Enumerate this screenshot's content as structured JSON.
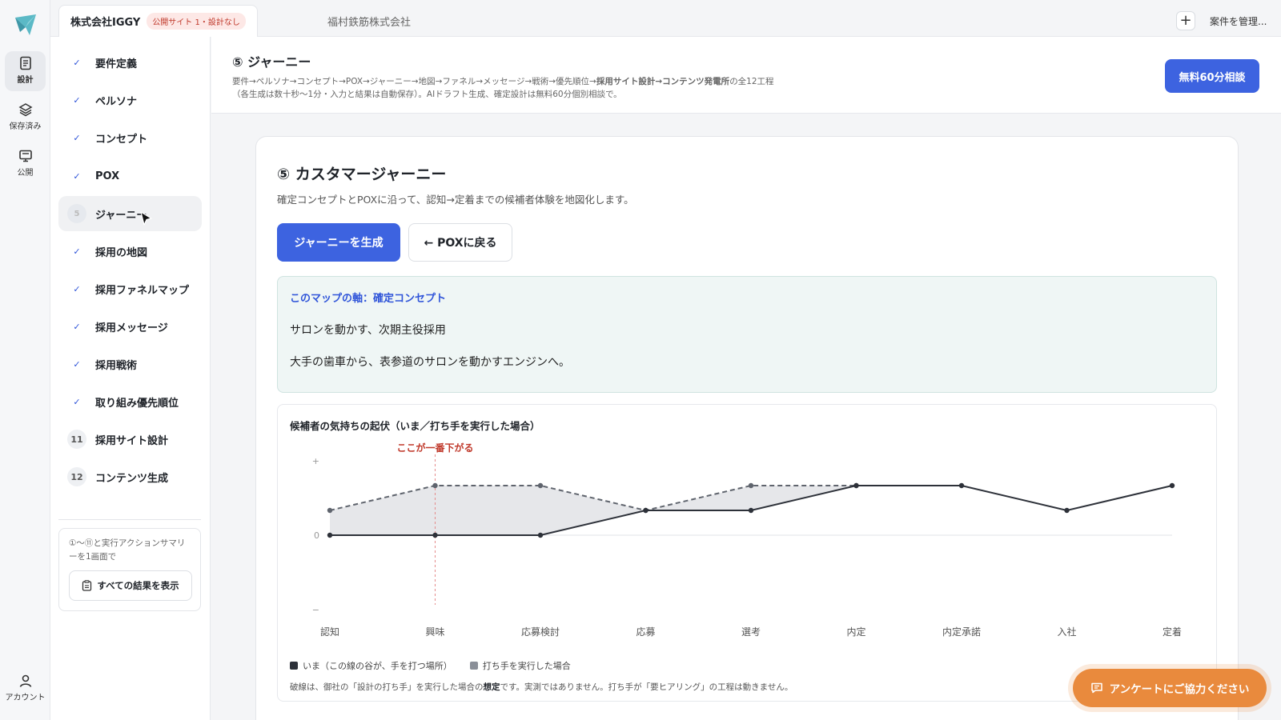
{
  "rail": {
    "items": [
      {
        "label": "設計",
        "icon": "document-icon"
      },
      {
        "label": "保存済み",
        "icon": "layers-icon"
      },
      {
        "label": "公開",
        "icon": "monitor-icon"
      }
    ],
    "account_label": "アカウント"
  },
  "tabs": {
    "active": {
      "label": "株式会社IGGY",
      "badge": "公開サイト 1・設計なし"
    },
    "second": {
      "label": "福村鉄筋株式会社"
    },
    "plus": "+",
    "manage": "案件を管理..."
  },
  "steps": [
    {
      "mark": "✓",
      "label": "要件定義"
    },
    {
      "mark": "✓",
      "label": "ペルソナ"
    },
    {
      "mark": "✓",
      "label": "コンセプト"
    },
    {
      "mark": "✓",
      "label": "POX"
    },
    {
      "mark": "5",
      "label": "ジャーニー"
    },
    {
      "mark": "✓",
      "label": "採用の地図"
    },
    {
      "mark": "✓",
      "label": "採用ファネルマップ"
    },
    {
      "mark": "✓",
      "label": "採用メッセージ"
    },
    {
      "mark": "✓",
      "label": "採用戦術"
    },
    {
      "mark": "✓",
      "label": "取り組み優先順位"
    },
    {
      "mark": "11",
      "label": "採用サイト設計"
    },
    {
      "mark": "12",
      "label": "コンテンツ生成"
    }
  ],
  "summary": {
    "text": "①〜⑪と実行アクションサマリーを1画面で",
    "button": "すべての結果を表示"
  },
  "header": {
    "title": "⑤ ジャーニー",
    "sub_line1_a": "要件→ペルソナ→コンセプト→POX→ジャーニー→地図→ファネル→メッセージ→戦術→優先順位→",
    "sub_line1_b": "採用サイト設計→コンテンツ発電所",
    "sub_line1_c": "の全12工程",
    "sub_line2": "（各生成は数十秒〜1分・入力と結果は自動保存）。AIドラフト生成、確定設計は無料60分個別相談で。",
    "cta": "無料60分相談"
  },
  "card": {
    "title": "⑤ カスタマージャーニー",
    "desc": "確定コンセプトとPOXに沿って、認知→定着までの候補者体験を地図化します。",
    "generate_button": "ジャーニーを生成",
    "back_button": "← POXに戻る",
    "axis_label": "このマップの軸：確定コンセプト",
    "axis_line1": "サロンを動かす、次期主役採用",
    "axis_line2": "大手の歯車から、表参道のサロンを動かすエンジンへ。",
    "chart_title": "候補者の気持ちの起伏（いま／打ち手を実行した場合）",
    "legend_now": "いま（この線の谷が、手を打つ場所）",
    "legend_after": "打ち手を実行した場合",
    "note_a": "破線は、御社の「設計の打ち手」を実行した場合の",
    "note_b": "想定",
    "note_c": "です。実測ではありません。打ち手が「要ヒアリング」の工程は動きません。"
  },
  "survey_button": "アンケートにご協力ください",
  "chart_data": {
    "type": "line",
    "categories": [
      "認知",
      "興味",
      "応募検討",
      "応募",
      "選考",
      "内定",
      "内定承諾",
      "入社",
      "定着"
    ],
    "series": [
      {
        "name": "いま（この線の谷が、手を打つ場所）",
        "values": [
          0,
          0,
          0,
          1,
          1,
          2,
          2,
          1,
          2
        ],
        "style": "solid",
        "color": "#2d3139"
      },
      {
        "name": "打ち手を実行した場合",
        "values": [
          1,
          2,
          2,
          1,
          2,
          2,
          null,
          null,
          null
        ],
        "style": "dashed",
        "color": "#5f646d"
      }
    ],
    "ylim": [
      -3,
      3
    ],
    "y_ticks": [
      {
        "value": 3,
        "label": "+"
      },
      {
        "value": 0,
        "label": "0"
      },
      {
        "value": -3,
        "label": "−"
      }
    ],
    "annotation": {
      "category": "興味",
      "label": "ここが一番下がる",
      "color": "#c0392b"
    },
    "fill_color": "#e6e7ea"
  }
}
